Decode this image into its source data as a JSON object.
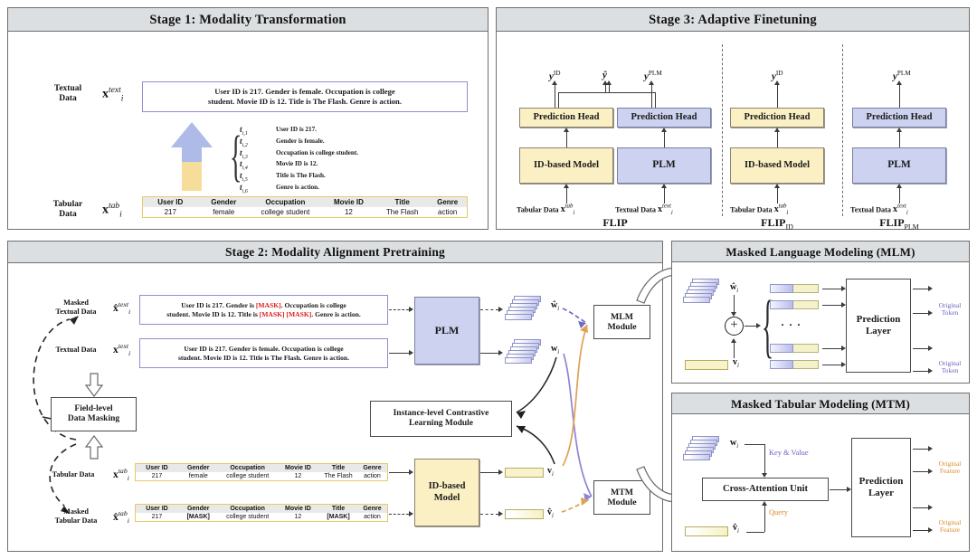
{
  "stage1": {
    "title": "Stage 1:  Modality Transformation",
    "textual_label_line1": "Textual",
    "textual_label_line2": "Data",
    "textual_symbol": "x",
    "textual_sup": "text",
    "textual_sub": "i",
    "sentence": "User ID is 217. Gender is female. Occupation is college student. Movie ID is 12. Title is The Flash. Genre is action.",
    "sentence_line1": "User ID is 217. Gender is female. Occupation is college",
    "sentence_line2": "student. Movie ID is 12. Title is The Flash. Genre is action.",
    "tabular_label_line1": "Tabular",
    "tabular_label_line2": "Data",
    "tabular_symbol": "x",
    "tabular_sup": "tab",
    "tabular_sub": "i",
    "fields": [
      {
        "symbol": "t",
        "sub": "i,1",
        "text": "User ID is 217."
      },
      {
        "symbol": "t",
        "sub": "i,2",
        "text": "Gender is female."
      },
      {
        "symbol": "t",
        "sub": "i,3",
        "text": "Occupation is college student."
      },
      {
        "symbol": "t",
        "sub": "i,4",
        "text": "Movie ID is 12."
      },
      {
        "symbol": "t",
        "sub": "i,5",
        "text": "Title is The Flash."
      },
      {
        "symbol": "t",
        "sub": "i,6",
        "text": "Genre is action."
      }
    ],
    "table": {
      "headers": [
        "User ID",
        "Gender",
        "Occupation",
        "Movie ID",
        "Title",
        "Genre"
      ],
      "row": [
        "217",
        "female",
        "college student",
        "12",
        "The Flash",
        "action"
      ]
    }
  },
  "stage3": {
    "title": "Stage 3:  Adaptive Finetuning",
    "columns": [
      {
        "name": "FLIP",
        "name_sub": "",
        "outputs": [
          "y",
          "ŷ",
          "y"
        ],
        "output_left_sup": "ID",
        "output_right_sup": "PLM",
        "heads": [
          "Prediction Head",
          "Prediction Head"
        ],
        "models": [
          "ID-based Model",
          "PLM"
        ],
        "inputs": [
          "Tabular Data",
          "Textual Data"
        ],
        "input_syms": [
          "x",
          "x"
        ],
        "input_sups": [
          "tab",
          "text"
        ]
      },
      {
        "name": "FLIP",
        "name_sub": "ID",
        "output": "y",
        "output_sup": "ID",
        "head": "Prediction Head",
        "model": "ID-based Model",
        "input": "Tabular Data",
        "input_sym": "x",
        "input_sup": "tab"
      },
      {
        "name": "FLIP",
        "name_sub": "PLM",
        "output": "y",
        "output_sup": "PLM",
        "head": "Prediction Head",
        "model": "PLM",
        "input": "Textual Data",
        "input_sym": "x",
        "input_sup": "text"
      }
    ]
  },
  "stage2": {
    "title": "Stage 2:  Modality Alignment Pretraining",
    "masked_textual_label_line1": "Masked",
    "masked_textual_label_line2": "Textual Data",
    "masked_textual_sym": "x̂",
    "masked_textual_sup": "text",
    "masked_sentence_line1_a": "User ID is 217. Gender is ",
    "masked_sentence_line1_mask": "[MASK]",
    "masked_sentence_line1_b": ". Occupation is college",
    "masked_sentence_line2_a": "student. Movie ID is 12. Title is ",
    "masked_sentence_line2_mask1": "[MASK]",
    "masked_sentence_line2_mask2": "[MASK]",
    "masked_sentence_line2_b": ". Genre is action.",
    "textual_label": "Textual Data",
    "textual_sym": "x",
    "textual_sup": "text",
    "sentence_line1": "User ID is 217. Gender is female. Occupation is college",
    "sentence_line2": "student. Movie ID is 12. Title is The Flash. Genre is action.",
    "masking_box_line1": "Field-level",
    "masking_box_line2": "Data Masking",
    "tabular_label": "Tabular Data",
    "tabular_sym": "x",
    "tabular_sup": "tab",
    "masked_tabular_label_line1": "Masked",
    "masked_tabular_label_line2": "Tabular Data",
    "masked_tabular_sym": "x̂",
    "masked_tabular_sup": "tab",
    "table_headers": [
      "User ID",
      "Gender",
      "Occupation",
      "Movie ID",
      "Title",
      "Genre"
    ],
    "table_row": [
      "217",
      "female",
      "college student",
      "12",
      "The Flash",
      "action"
    ],
    "masked_table_row": [
      "217",
      "[MASK]",
      "college student",
      "12",
      "[MASK]",
      "action"
    ],
    "plm": "PLM",
    "id_model_line1": "ID-based",
    "id_model_line2": "Model",
    "contrastive_line1": "Instance-level Contrastive",
    "contrastive_line2": "Learning Module",
    "mlm_module_line1": "MLM",
    "mlm_module_line2": "Module",
    "mtm_module_line1": "MTM",
    "mtm_module_line2": "Module",
    "w_hat": "ŵ",
    "w": "w",
    "v": "v",
    "v_hat": "v̂",
    "sub_i": "i"
  },
  "mlm": {
    "title": "Masked Language Modeling (MLM)",
    "w_hat": "ŵ",
    "v": "v",
    "sub_i": "i",
    "plus": "⊕",
    "ellipsis": "· · ·",
    "prediction_layer_line1": "Prediction",
    "prediction_layer_line2": "Layer",
    "output_line1": "Original",
    "output_line2": "Token",
    "n_token_rows": 4
  },
  "mtm": {
    "title": "Masked Tabular Modeling (MTM)",
    "w": "w",
    "v_hat": "v̂",
    "sub_i": "i",
    "key_value": "Key & Value",
    "query": "Query",
    "cross_attention": "Cross-Attention Unit",
    "prediction_layer_line1": "Prediction",
    "prediction_layer_line2": "Layer",
    "output_line1": "Original",
    "output_line2": "Feature"
  },
  "colors": {
    "yellow_fill": "#fbf0c4",
    "blue_fill": "#ccd2f0",
    "panel_header": "#dcdfe1",
    "mask_red": "#e02020",
    "token_purple": "#6a63c8",
    "feature_orange": "#d98b2b",
    "table_border": "#e8c96a",
    "table_header": "#e9e9e9"
  }
}
